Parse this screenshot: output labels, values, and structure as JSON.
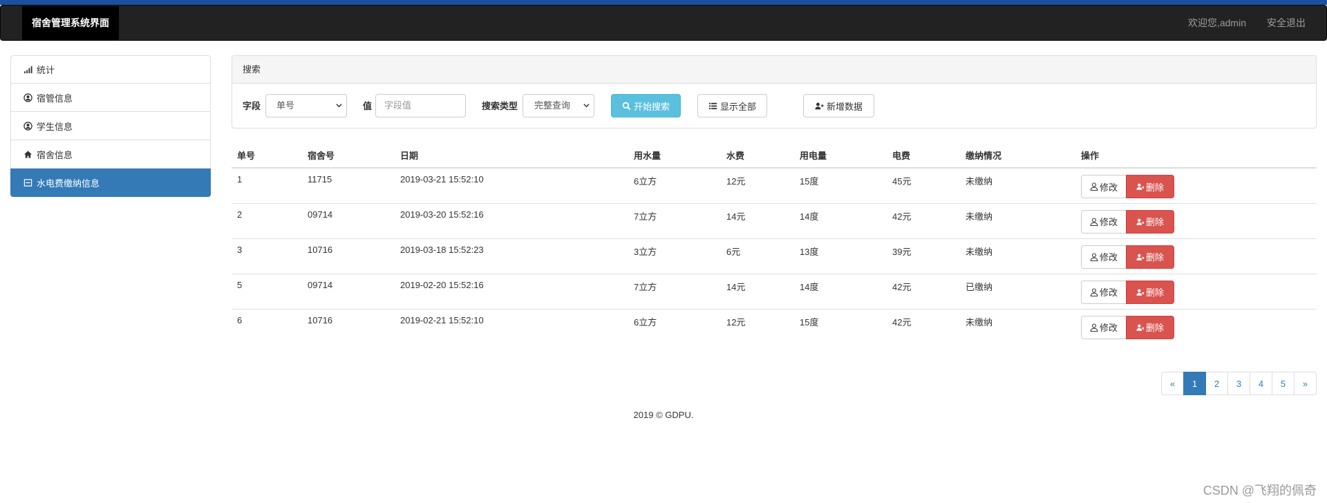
{
  "header": {
    "brand": "宿舍管理系统界面",
    "welcome": "欢迎您,admin",
    "logout": "安全退出"
  },
  "sidebar": {
    "items": [
      {
        "label": "统计",
        "icon": "signal-icon"
      },
      {
        "label": "宿管信息",
        "icon": "user-circle-icon"
      },
      {
        "label": "学生信息",
        "icon": "user-circle-icon"
      },
      {
        "label": "宿舍信息",
        "icon": "home-icon"
      },
      {
        "label": "水电费缴纳信息",
        "icon": "list-box-icon",
        "active": true
      }
    ]
  },
  "search": {
    "heading": "搜索",
    "field_label": "字段",
    "field_value": "单号",
    "value_label": "值",
    "value_placeholder": "字段值",
    "type_label": "搜索类型",
    "type_value": "完整查询",
    "search_button": "开始搜索",
    "show_all_button": "显示全部",
    "add_button": "新增数据"
  },
  "table": {
    "columns": [
      "单号",
      "宿舍号",
      "日期",
      "用水量",
      "水费",
      "用电量",
      "电费",
      "缴纳情况",
      "操作"
    ],
    "rows": [
      {
        "id": "1",
        "dorm": "11715",
        "date": "2019-03-21 15:52:10",
        "water": "6立方",
        "water_fee": "12元",
        "power": "15度",
        "power_fee": "45元",
        "status": "未缴纳",
        "paid": false
      },
      {
        "id": "2",
        "dorm": "09714",
        "date": "2019-03-20 15:52:16",
        "water": "7立方",
        "water_fee": "14元",
        "power": "14度",
        "power_fee": "42元",
        "status": "未缴纳",
        "paid": false
      },
      {
        "id": "3",
        "dorm": "10716",
        "date": "2019-03-18 15:52:23",
        "water": "3立方",
        "water_fee": "6元",
        "power": "13度",
        "power_fee": "39元",
        "status": "未缴纳",
        "paid": false
      },
      {
        "id": "5",
        "dorm": "09714",
        "date": "2019-02-20 15:52:16",
        "water": "7立方",
        "water_fee": "14元",
        "power": "14度",
        "power_fee": "42元",
        "status": "已缴纳",
        "paid": true
      },
      {
        "id": "6",
        "dorm": "10716",
        "date": "2019-02-21 15:52:10",
        "water": "6立方",
        "water_fee": "12元",
        "power": "15度",
        "power_fee": "42元",
        "status": "未缴纳",
        "paid": false
      }
    ],
    "edit_label": "修改",
    "delete_label": "删除"
  },
  "pagination": {
    "prev": "«",
    "pages": [
      "1",
      "2",
      "3",
      "4",
      "5"
    ],
    "current": "1",
    "next": "»"
  },
  "footer": "2019 © GDPU.",
  "watermark": "CSDN @飞翔的佩奇",
  "colors": {
    "primary": "#337ab7",
    "info": "#5bc0de",
    "danger": "#d9534f",
    "unpaid": "#ff0000",
    "navbar": "#222222"
  }
}
